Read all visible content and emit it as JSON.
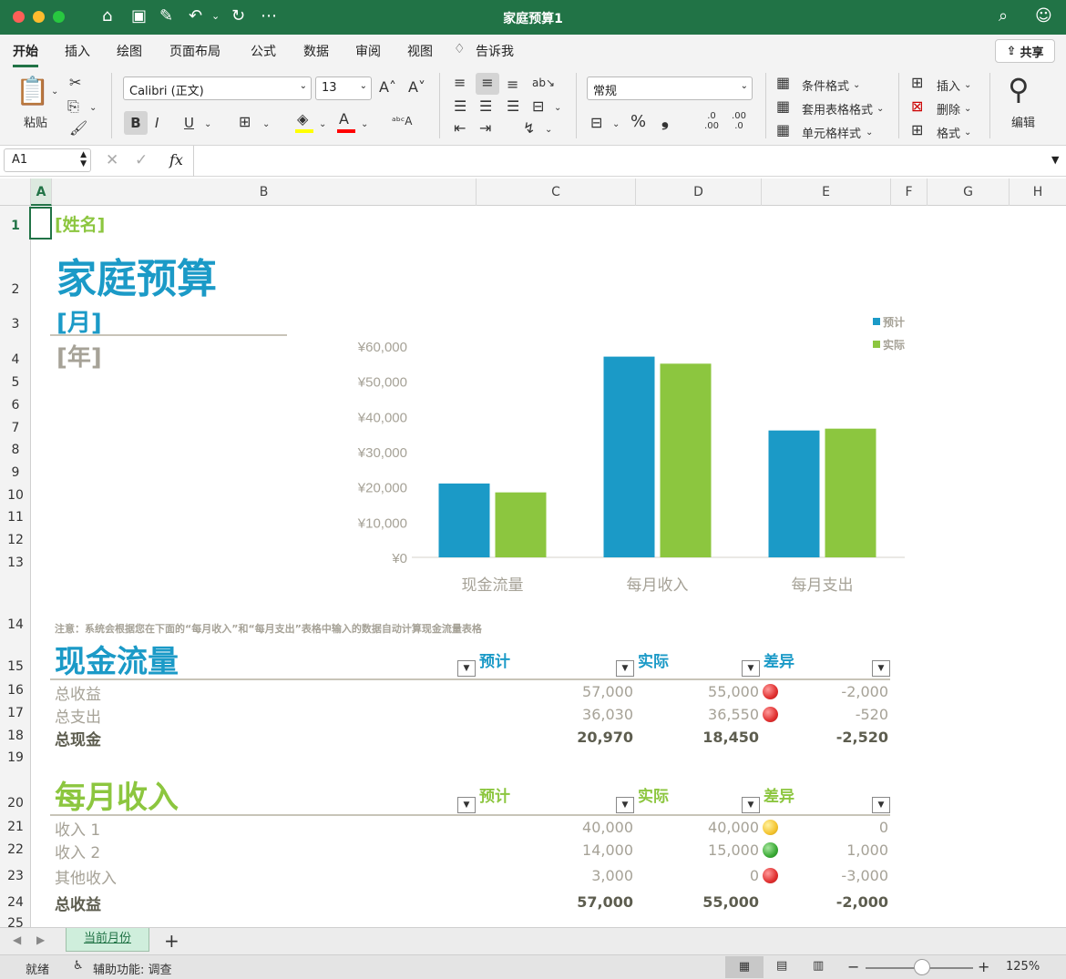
{
  "window": {
    "title": "家庭预算1",
    "colors": {
      "titlebar": "#217346",
      "green": "#8cc63f",
      "blue": "#1b9ac7",
      "gray": "#a6a297"
    }
  },
  "ribbon_tabs": [
    "开始",
    "插入",
    "绘图",
    "页面布局",
    "公式",
    "数据",
    "审阅",
    "视图",
    "告诉我"
  ],
  "share_label": "共享",
  "ribbon": {
    "paste_label": "粘贴",
    "font_name": "Calibri (正文)",
    "font_size": "13",
    "bold": "B",
    "italic": "I",
    "underline": "U",
    "number_format": "常规",
    "percent": "%",
    "comma": "❟",
    "inc_decimal": ".0 .00",
    "dec_decimal": ".00 .0",
    "conditional_format": "条件格式",
    "table_format": "套用表格格式",
    "cell_style": "单元格样式",
    "insert": "插入",
    "delete": "删除",
    "format": "格式",
    "edit": "编辑"
  },
  "formula_bar": {
    "name_box": "A1",
    "fx": "fx",
    "formula": ""
  },
  "columns": [
    "A",
    "B",
    "C",
    "D",
    "E",
    "F",
    "G",
    "H"
  ],
  "rows": [
    "1",
    "2",
    "3",
    "4",
    "5",
    "6",
    "7",
    "8",
    "9",
    "10",
    "11",
    "12",
    "13",
    "14",
    "15",
    "16",
    "17",
    "18",
    "19",
    "20",
    "21",
    "22",
    "23",
    "24",
    "25"
  ],
  "sheet": {
    "name_placeholder": "[姓名]",
    "title": "家庭预算",
    "month_placeholder": "[月]",
    "year_placeholder": "[年]",
    "note": "注意：系统会根据您在下面的“每月收入”和“每月支出”表格中输入的数据自动计算现金流量表格"
  },
  "chart_data": {
    "type": "bar",
    "categories": [
      "现金流量",
      "每月收入",
      "每月支出"
    ],
    "series": [
      {
        "name": "预计",
        "values": [
          20970,
          57000,
          36030
        ],
        "color": "#1b9ac7"
      },
      {
        "name": "实际",
        "values": [
          18450,
          55000,
          36550
        ],
        "color": "#8cc63f"
      }
    ],
    "y_ticks": [
      "¥0",
      "¥10,000",
      "¥20,000",
      "¥30,000",
      "¥40,000",
      "¥50,000",
      "¥60,000"
    ],
    "ylim": [
      0,
      60000
    ],
    "legend": "top-right",
    "grid": false
  },
  "cashflow": {
    "title": "现金流量",
    "headers": {
      "planned": "预计",
      "actual": "实际",
      "diff": "差异"
    },
    "rows": [
      {
        "label": "总收益",
        "planned": "57,000",
        "actual": "55,000",
        "diff": "-2,000",
        "status": "red"
      },
      {
        "label": "总支出",
        "planned": "36,030",
        "actual": "36,550",
        "diff": "-520",
        "status": "red"
      },
      {
        "label": "总现金",
        "planned": "20,970",
        "actual": "18,450",
        "diff": "-2,520",
        "status": ""
      }
    ]
  },
  "income": {
    "title": "每月收入",
    "headers": {
      "planned": "预计",
      "actual": "实际",
      "diff": "差异"
    },
    "rows": [
      {
        "label": "收入 1",
        "planned": "40,000",
        "actual": "40,000",
        "diff": "0",
        "status": "yellow"
      },
      {
        "label": "收入 2",
        "planned": "14,000",
        "actual": "15,000",
        "diff": "1,000",
        "status": "green"
      },
      {
        "label": "其他收入",
        "planned": "3,000",
        "actual": "0",
        "diff": "-3,000",
        "status": "red"
      },
      {
        "label": "总收益",
        "planned": "57,000",
        "actual": "55,000",
        "diff": "-2,000",
        "status": ""
      }
    ]
  },
  "sheet_tab": "当前月份",
  "status": {
    "ready": "就绪",
    "accessibility": "辅助功能: 调查",
    "zoom": "125%"
  }
}
